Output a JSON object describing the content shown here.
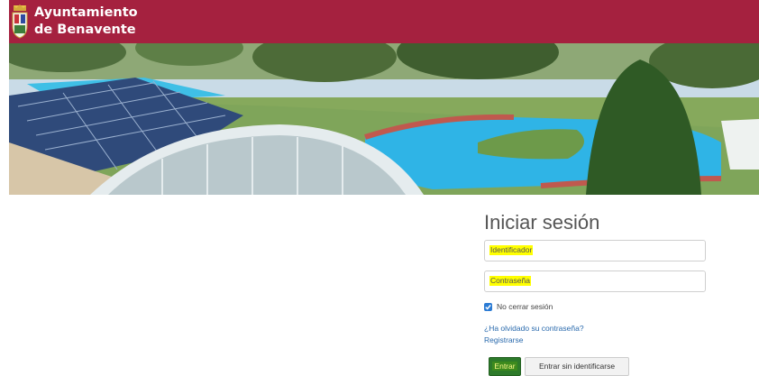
{
  "header": {
    "org_line1": "Ayuntamiento",
    "org_line2": "de Benavente",
    "brand_color": "#a5213f"
  },
  "hero": {
    "icon": "pool-photo"
  },
  "login": {
    "title": "Iniciar sesión",
    "identifier_placeholder": "Identificador",
    "password_placeholder": "Contraseña",
    "keep_session_label": "No cerrar sesión",
    "keep_session_checked": true,
    "forgot_password": "¿Ha olvidado su contraseña?",
    "register": "Registrarse",
    "submit_label": "Entrar",
    "guest_label": "Entrar sin identificarse"
  }
}
